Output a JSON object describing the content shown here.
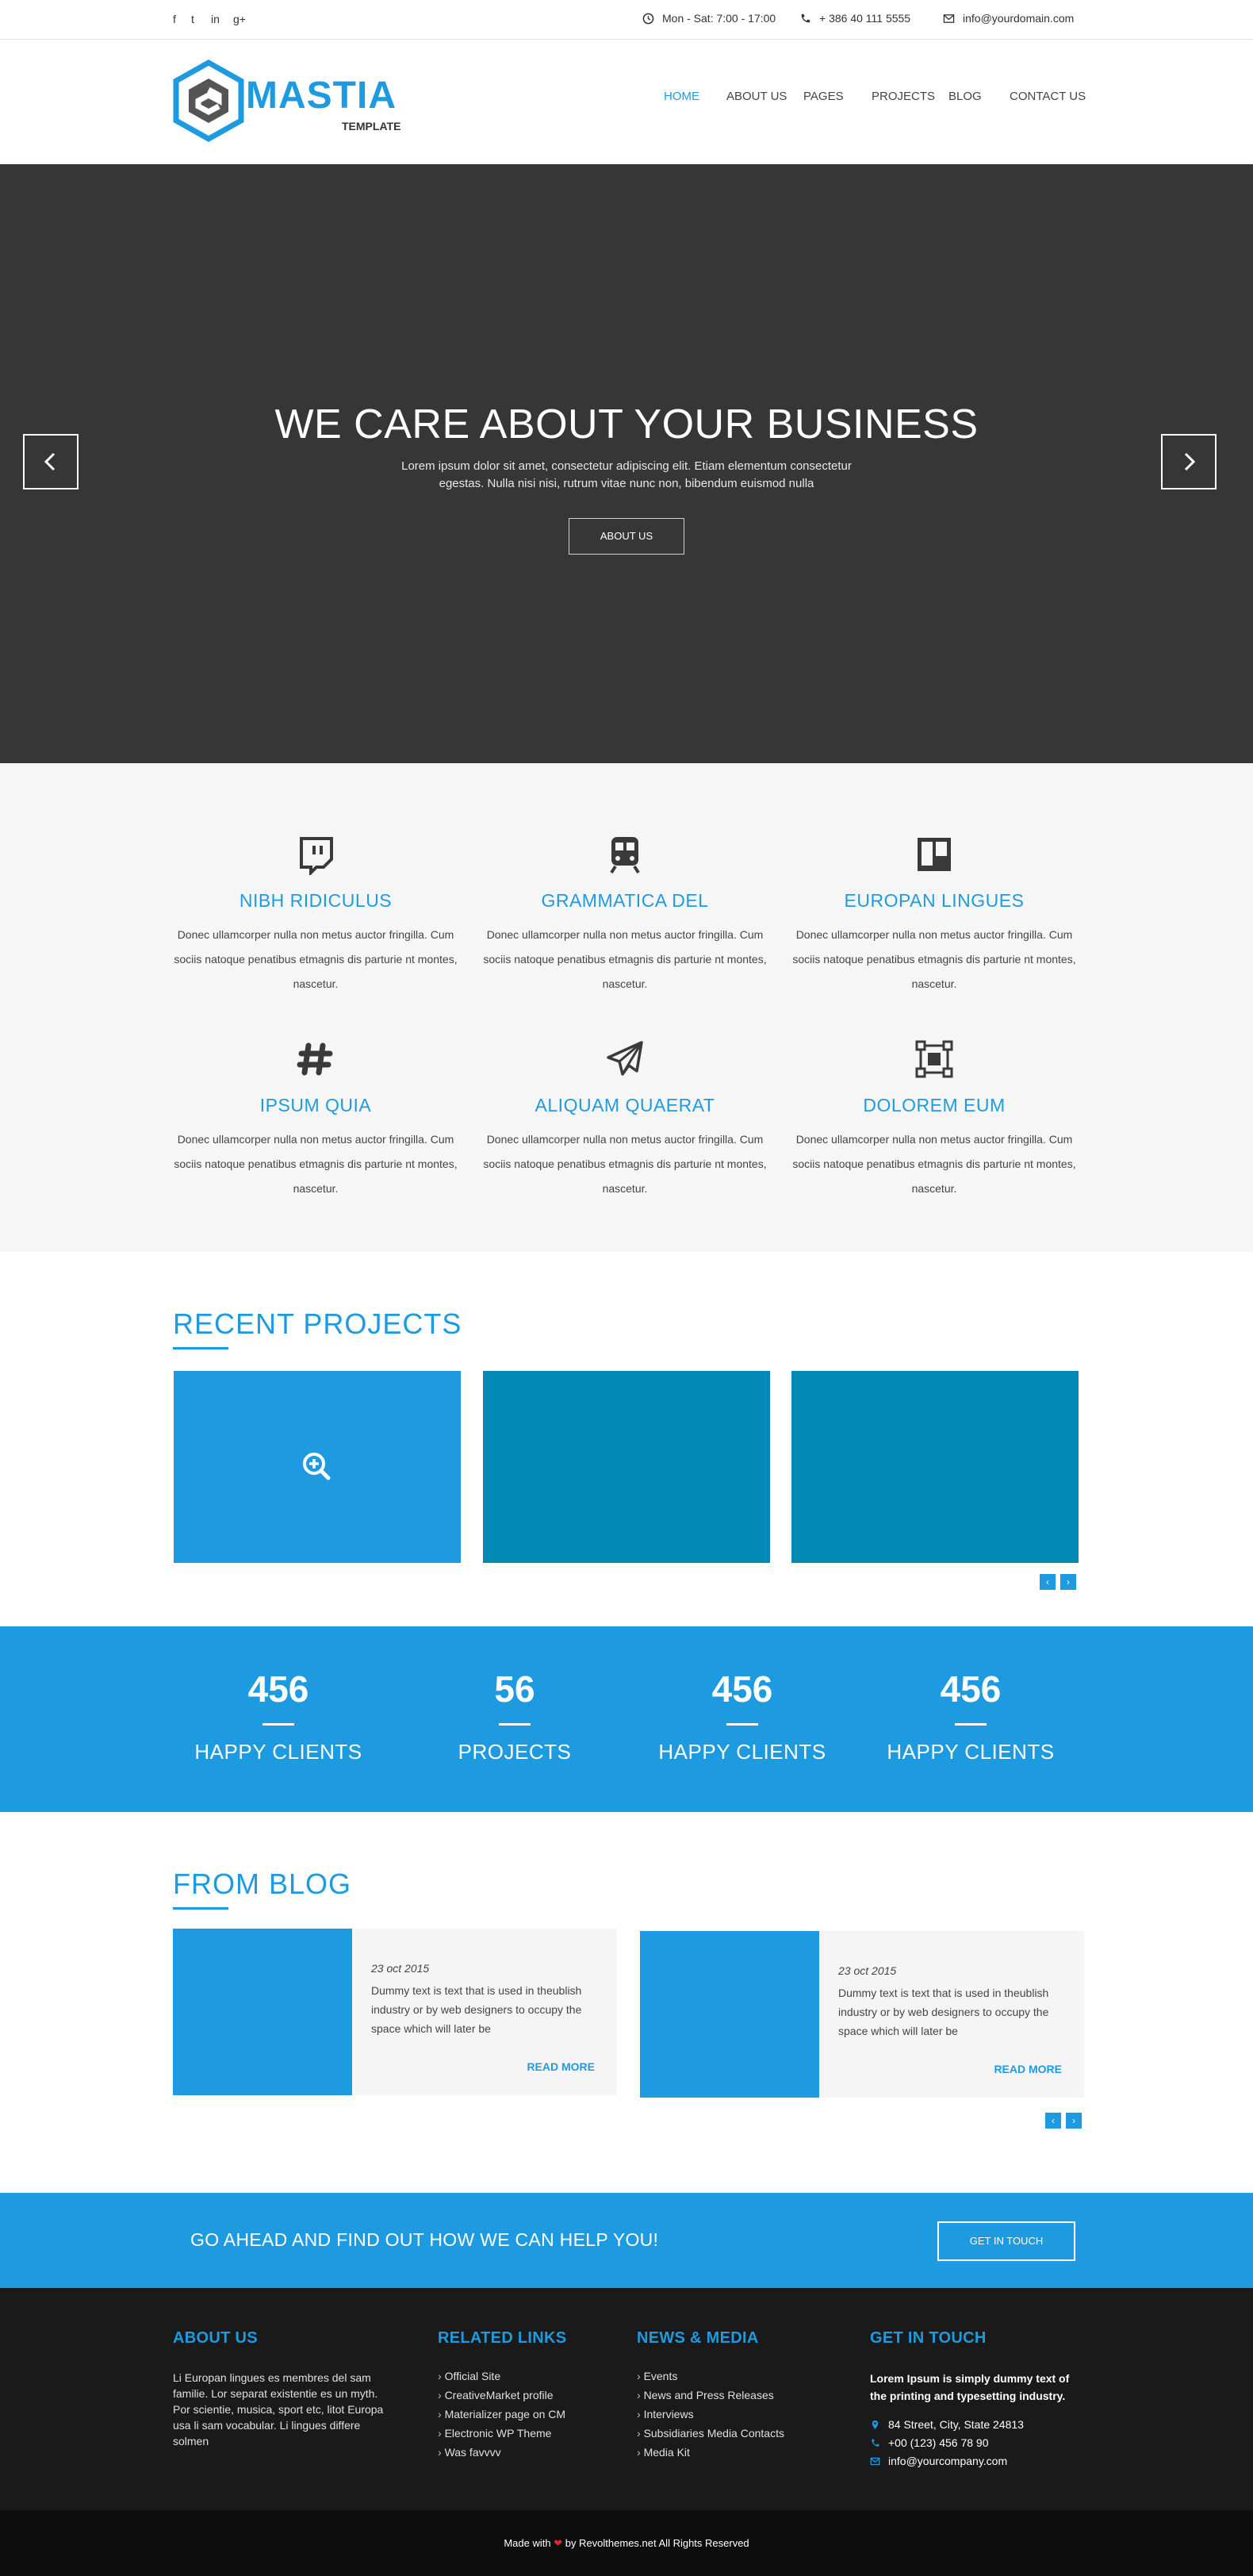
{
  "topbar": {
    "social": [
      "f",
      "t",
      "in",
      "g+"
    ],
    "hours": "Mon - Sat: 7:00 - 17:00",
    "phone": "+ 386 40 111 5555",
    "email": "info@yourdomain.com"
  },
  "logo": {
    "name": "MASTIA",
    "sub": "TEMPLATE"
  },
  "nav": [
    "HOME",
    "ABOUT US",
    "PAGES",
    "PROJECTS",
    "BLOG",
    "CONTACT US"
  ],
  "hero": {
    "title": "WE CARE ABOUT YOUR BUSINESS",
    "text": "Lorem ipsum dolor sit amet, consectetur adipiscing elit. Etiam elementum consectetur egestas. Nulla nisi nisi, rutrum vitae nunc non, bibendum euismod nulla",
    "button": "ABOUT US"
  },
  "services": [
    {
      "icon": "twitch-icon",
      "title": "NIBH RIDICULUS",
      "text": "Donec ullamcorper nulla non metus auctor fringilla. Cum sociis natoque penatibus etmagnis dis parturie nt montes, nascetur."
    },
    {
      "icon": "train-icon",
      "title": "GRAMMATICA DEL",
      "text": "Donec ullamcorper nulla non metus auctor fringilla. Cum sociis natoque penatibus etmagnis dis parturie nt montes, nascetur."
    },
    {
      "icon": "trello-icon",
      "title": "EUROPAN LINGUES",
      "text": "Donec ullamcorper nulla non metus auctor fringilla. Cum sociis natoque penatibus etmagnis dis parturie nt montes, nascetur."
    },
    {
      "icon": "slack-hash-icon",
      "title": "IPSUM QUIA",
      "text": "Donec ullamcorper nulla non metus auctor fringilla. Cum sociis natoque penatibus etmagnis dis parturie nt montes, nascetur."
    },
    {
      "icon": "paper-plane-icon",
      "title": "ALIQUAM QUAERAT",
      "text": "Donec ullamcorper nulla non metus auctor fringilla. Cum sociis natoque penatibus etmagnis dis parturie nt montes, nascetur."
    },
    {
      "icon": "object-group-icon",
      "title": "DOLOREM EUM",
      "text": "Donec ullamcorper nulla non metus auctor fringilla. Cum sociis natoque penatibus etmagnis dis parturie nt montes, nascetur."
    }
  ],
  "projects": {
    "title": "RECENT PROJECTS",
    "tile_colors": [
      "#1e9be0",
      "#0089b4",
      "#0089b4"
    ]
  },
  "stats": [
    {
      "num": "456",
      "label": "HAPPY CLIENTS"
    },
    {
      "num": "56",
      "label": "PROJECTS"
    },
    {
      "num": "456",
      "label": "HAPPY CLIENTS"
    },
    {
      "num": "456",
      "label": "HAPPY CLIENTS"
    }
  ],
  "blog": {
    "title": "FROM BLOG",
    "posts": [
      {
        "date": "23 oct 2015",
        "text": "Dummy text is text that is used in theublish industry or by web designers to occupy the space which will later be",
        "more": "READ MORE"
      },
      {
        "date": "23 oct 2015",
        "text": "Dummy text is text that is used in theublish industry or by web designers to occupy the space which will later be",
        "more": "READ MORE"
      }
    ]
  },
  "cta": {
    "text": "GO AHEAD AND FIND OUT HOW WE CAN HELP YOU!",
    "button": "GET IN TOUCH"
  },
  "footer": {
    "about": {
      "title": "ABOUT US",
      "text": "Li Europan lingues es membres del sam familie. Lor separat existentie es un myth. Por scientie, musica, sport etc, litot Europa usa li sam vocabular. Li lingues differe solmen"
    },
    "links": {
      "title": "RELATED LINKS",
      "items": [
        "Official Site",
        "CreativeMarket profile",
        "Materializer page on CM",
        "Electronic WP Theme",
        "Was favvvv"
      ]
    },
    "news": {
      "title": "NEWS & MEDIA",
      "items": [
        "Events",
        "News and Press Releases",
        "Interviews",
        "Subsidiaries Media Contacts",
        "Media Kit"
      ]
    },
    "contact": {
      "title": "GET IN TOUCH",
      "intro": "Lorem Ipsum is simply dummy text of the printing and typesetting industry.",
      "address": "84 Street, City, State 24813",
      "phone": "+00 (123) 456 78 90",
      "email": "info@yourcompany.com"
    }
  },
  "bottom": {
    "before": "Made with",
    "after": "by Revolthemes.net All Rights Reserved"
  }
}
